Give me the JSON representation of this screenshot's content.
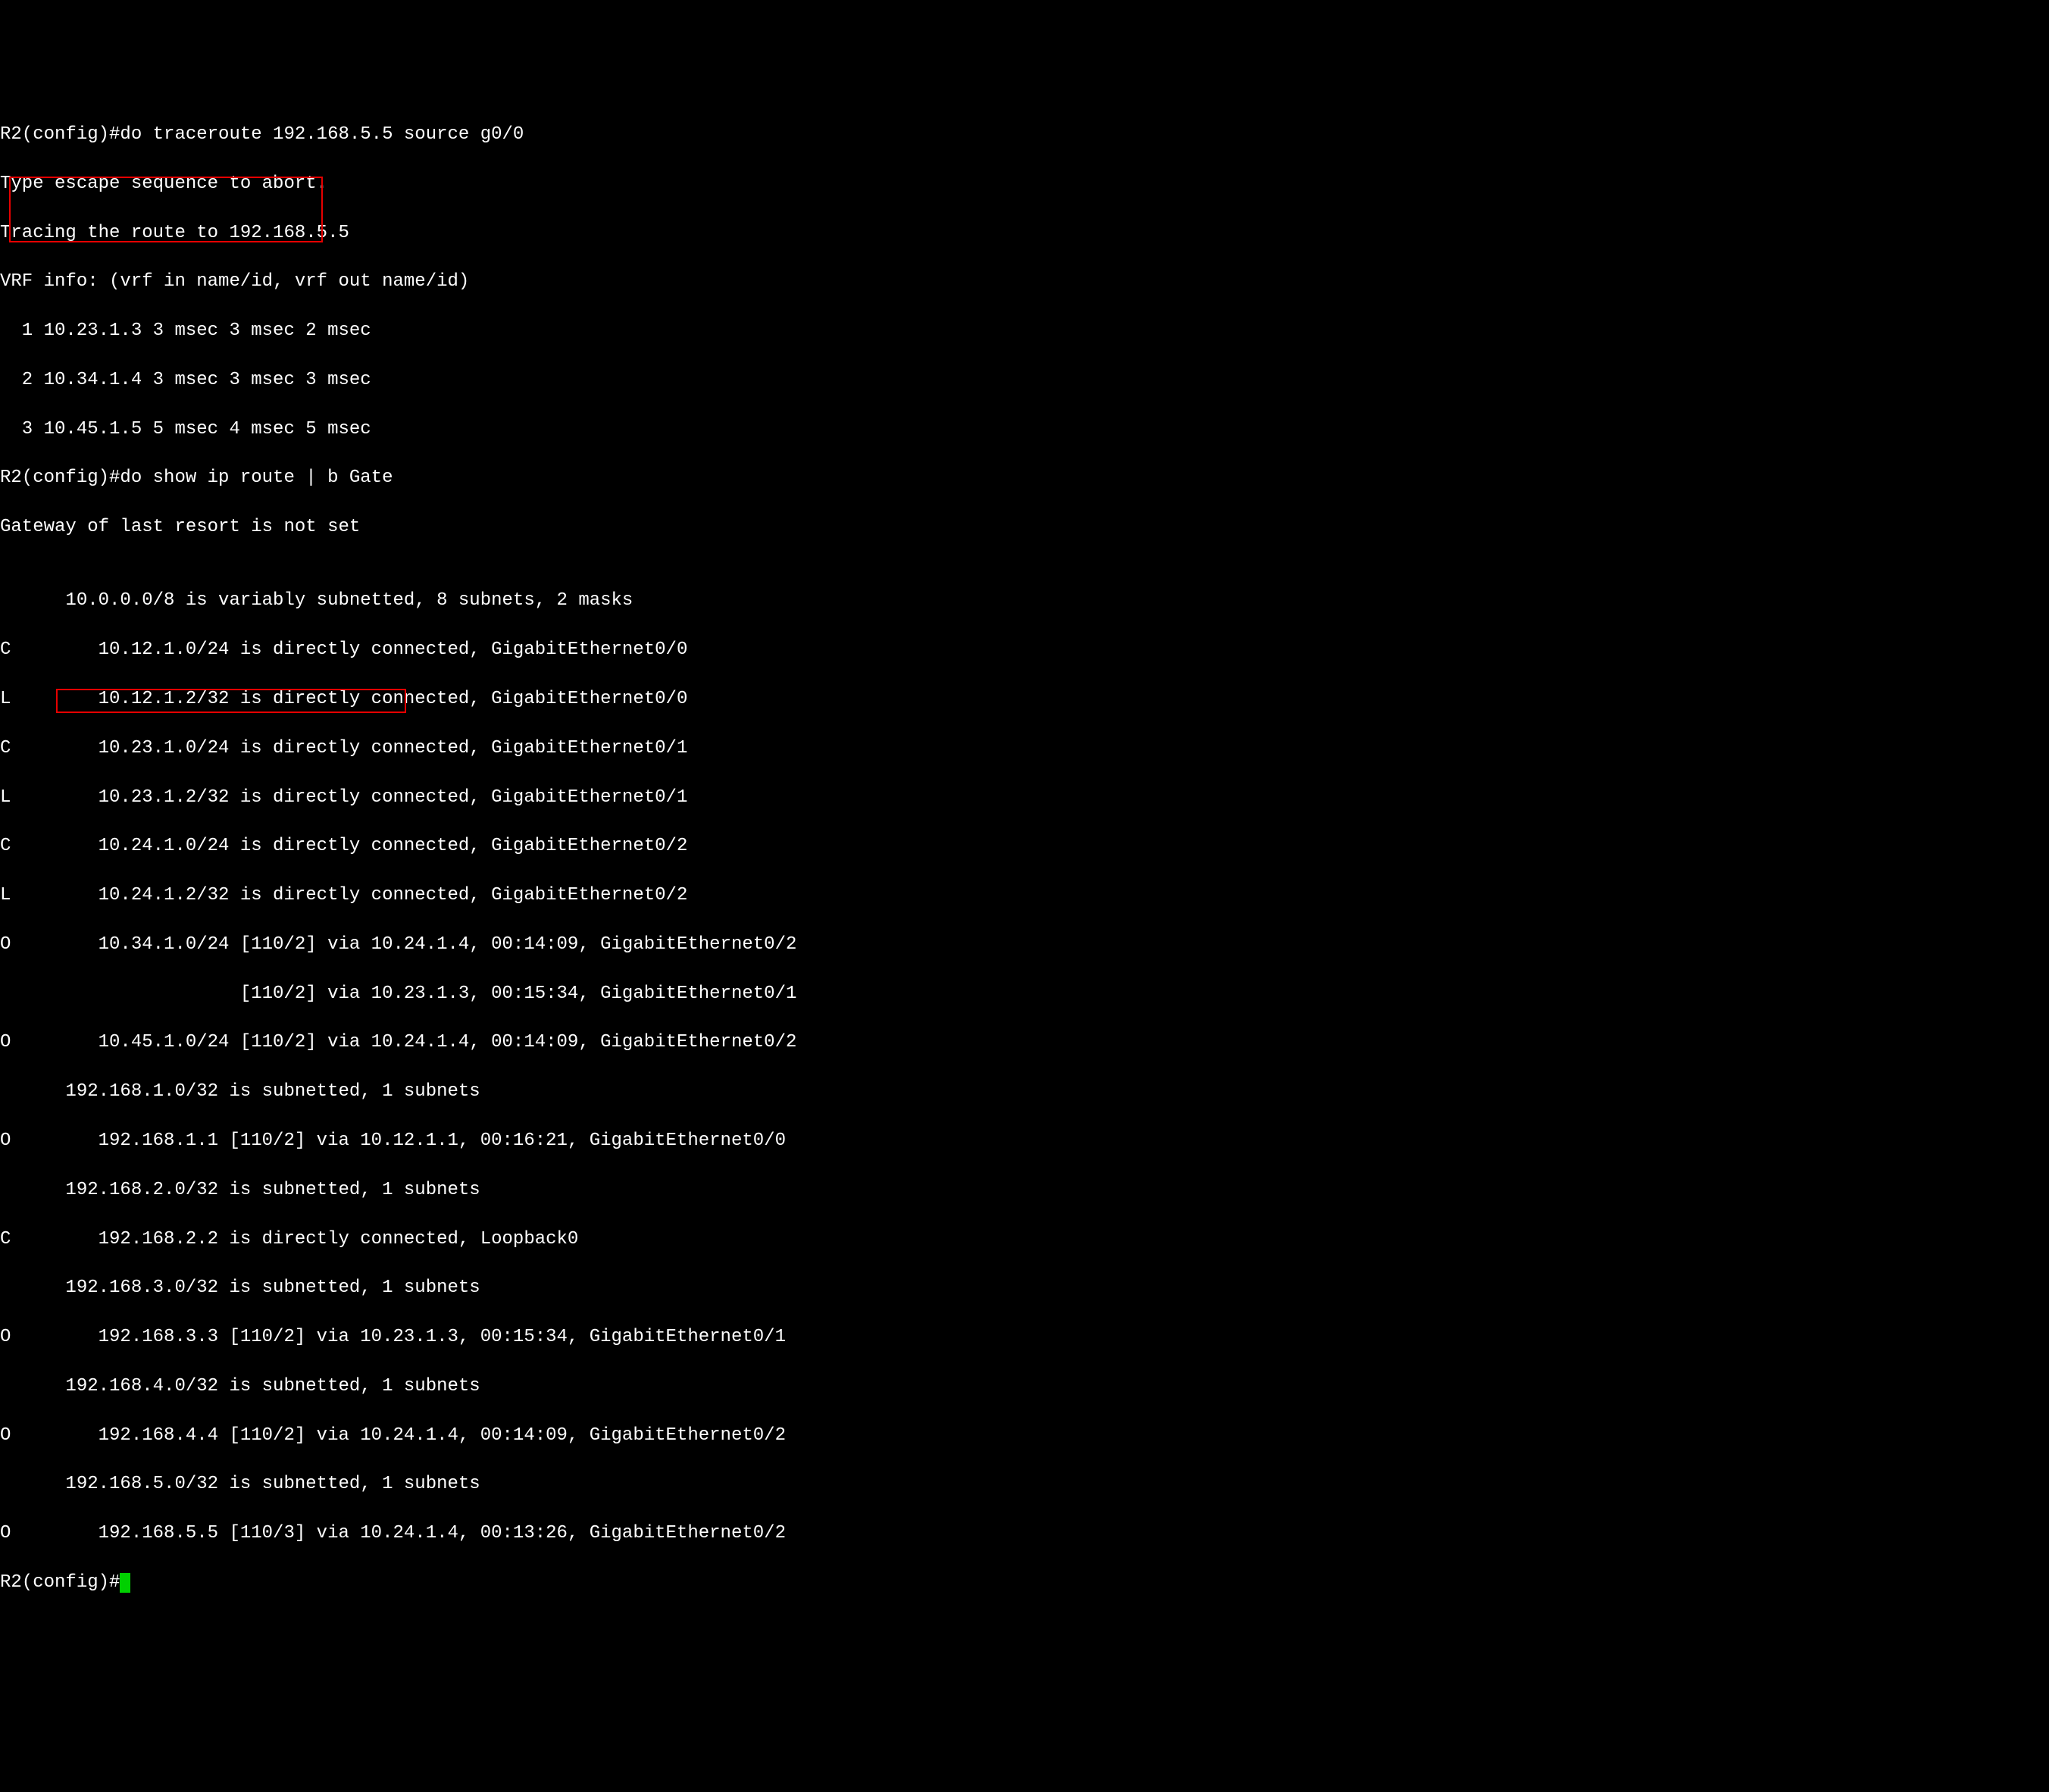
{
  "lines": {
    "l1": "R2(config)#do traceroute 192.168.5.5 source g0/0",
    "l2": "Type escape sequence to abort.",
    "l3": "Tracing the route to 192.168.5.5",
    "l4": "VRF info: (vrf in name/id, vrf out name/id)",
    "l5": "  1 10.23.1.3 3 msec 3 msec 2 msec",
    "l6": "  2 10.34.1.4 3 msec 3 msec 3 msec",
    "l7": "  3 10.45.1.5 5 msec 4 msec 5 msec",
    "l8": "R2(config)#do show ip route | b Gate",
    "l9": "Gateway of last resort is not set",
    "l10": "",
    "l11": "      10.0.0.0/8 is variably subnetted, 8 subnets, 2 masks",
    "l12": "C        10.12.1.0/24 is directly connected, GigabitEthernet0/0",
    "l13": "L        10.12.1.2/32 is directly connected, GigabitEthernet0/0",
    "l14": "C        10.23.1.0/24 is directly connected, GigabitEthernet0/1",
    "l15": "L        10.23.1.2/32 is directly connected, GigabitEthernet0/1",
    "l16": "C        10.24.1.0/24 is directly connected, GigabitEthernet0/2",
    "l17": "L        10.24.1.2/32 is directly connected, GigabitEthernet0/2",
    "l18": "O        10.34.1.0/24 [110/2] via 10.24.1.4, 00:14:09, GigabitEthernet0/2",
    "l19": "                      [110/2] via 10.23.1.3, 00:15:34, GigabitEthernet0/1",
    "l20": "O        10.45.1.0/24 [110/2] via 10.24.1.4, 00:14:09, GigabitEthernet0/2",
    "l21": "      192.168.1.0/32 is subnetted, 1 subnets",
    "l22": "O        192.168.1.1 [110/2] via 10.12.1.1, 00:16:21, GigabitEthernet0/0",
    "l23": "      192.168.2.0/32 is subnetted, 1 subnets",
    "l24": "C        192.168.2.2 is directly connected, Loopback0",
    "l25": "      192.168.3.0/32 is subnetted, 1 subnets",
    "l26": "O        192.168.3.3 [110/2] via 10.23.1.3, 00:15:34, GigabitEthernet0/1",
    "l27": "      192.168.4.0/32 is subnetted, 1 subnets",
    "l28": "O        192.168.4.4 [110/2] via 10.24.1.4, 00:14:09, GigabitEthernet0/2",
    "l29": "      192.168.5.0/32 is subnetted, 1 subnets",
    "l30": "O        192.168.5.5 [110/3] via 10.24.1.4, 00:13:26, GigabitEthernet0/2",
    "l31": "R2(config)#"
  }
}
